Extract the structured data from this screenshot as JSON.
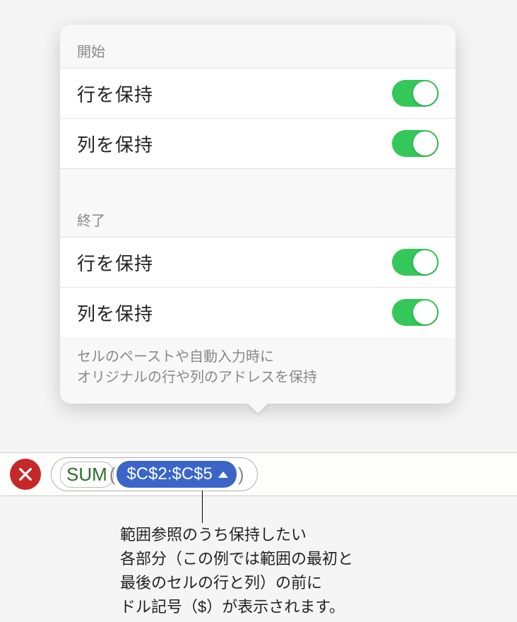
{
  "popover": {
    "section1": {
      "header": "開始",
      "row1": {
        "label": "行を保持",
        "on": true
      },
      "row2": {
        "label": "列を保持",
        "on": true
      }
    },
    "section2": {
      "header": "終了",
      "row1": {
        "label": "行を保持",
        "on": true
      },
      "row2": {
        "label": "列を保持",
        "on": true
      }
    },
    "footer": "セルのペーストや自動入力時に\nオリジナルの行や列のアドレスを保持"
  },
  "formula": {
    "function_name": "SUM",
    "open_paren": "(",
    "reference": "$C$2:$C$5",
    "close_paren": ")"
  },
  "callout": "範囲参照のうち保持したい\n各部分（この例では範囲の最初と\n最後のセルの行と列）の前に\nドル記号（$）が表示されます。"
}
